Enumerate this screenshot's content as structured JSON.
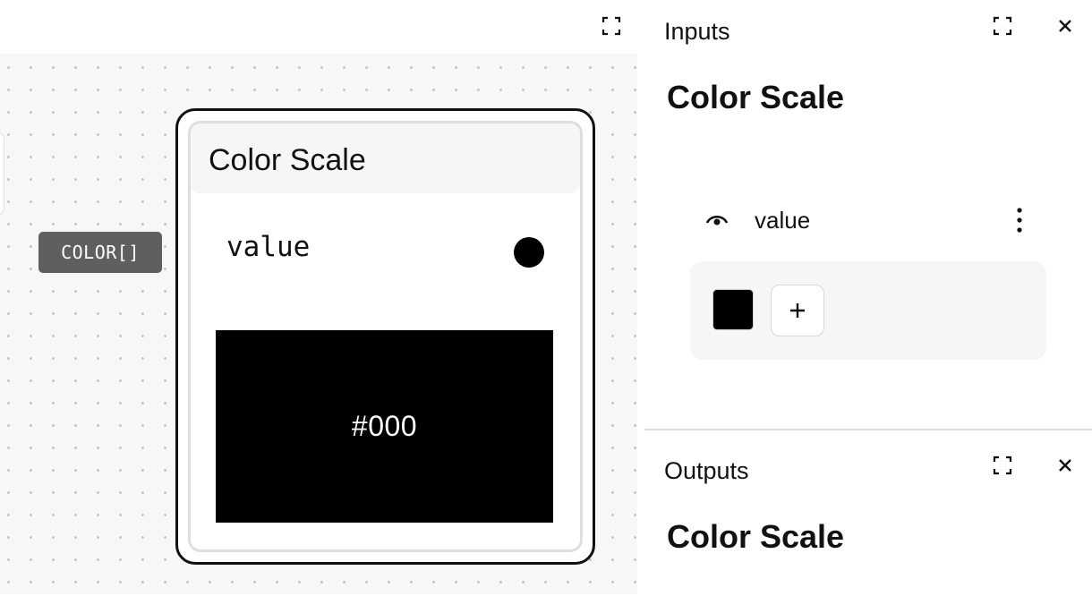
{
  "canvas": {
    "type_tag": "COLOR[]",
    "node": {
      "title": "Color Scale",
      "field_label": "value",
      "preview_hex": "#000",
      "preview_color": "#000000"
    },
    "port_in_color": "#c96a60"
  },
  "inputs_panel": {
    "label": "Inputs",
    "heading": "Color Scale",
    "param": {
      "name": "value",
      "icon": "eye-icon"
    },
    "colors": [
      "#000000"
    ],
    "add_icon": "plus-icon"
  },
  "outputs_panel": {
    "label": "Outputs",
    "heading": "Color Scale"
  },
  "icons": {
    "expand": "expand-icon",
    "close": "close-icon",
    "more": "more-vertical-icon"
  }
}
